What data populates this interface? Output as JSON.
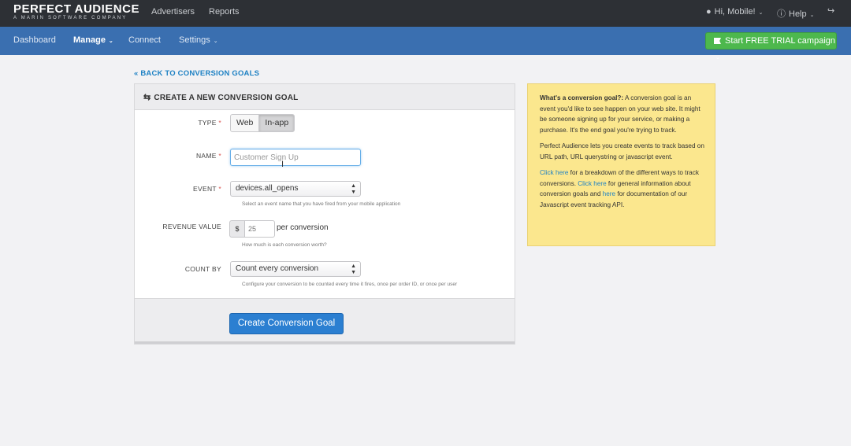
{
  "header": {
    "logo_main": "PERFECT AUDIENCE",
    "logo_sub": "A MARIN SOFTWARE COMPANY",
    "nav": [
      "Advertisers",
      "Reports"
    ],
    "user_label": "Hi, Mobile!",
    "help_label": "Help",
    "user_icon": "user-icon",
    "help_icon": "info-icon",
    "logout_icon": "logout-icon"
  },
  "subnav": {
    "items": [
      {
        "label": "Dashboard",
        "active": false
      },
      {
        "label": "Manage",
        "active": true
      },
      {
        "label": "Connect",
        "active": false
      },
      {
        "label": "Settings",
        "active": false
      }
    ],
    "trial_button": "Start FREE TRIAL campaign"
  },
  "back_link": "« BACK TO CONVERSION GOALS",
  "form": {
    "title": "CREATE A NEW CONVERSION GOAL",
    "type_label": "TYPE",
    "type_options": [
      "Web",
      "In-app"
    ],
    "type_selected": "In-app",
    "name_label": "NAME",
    "name_placeholder": "Customer Sign Up",
    "name_value": "",
    "event_label": "EVENT",
    "event_value": "devices.all_opens",
    "event_help": "Select an event name that you have fired from your mobile application",
    "revenue_label": "REVENUE VALUE",
    "currency_symbol": "$",
    "revenue_value": "25",
    "revenue_suffix": "per conversion",
    "revenue_help": "How much is each conversion worth?",
    "count_label": "COUNT BY",
    "count_value": "Count every conversion",
    "count_help": "Configure your conversion to be counted every time it fires, once per order ID, or once per user",
    "submit_label": "Create Conversion Goal",
    "required_mark": "*"
  },
  "info": {
    "heading": "What's a conversion goal?:",
    "p1_rest": " A conversion goal is an event you'd like to see happen on your web site. It might be someone signing up for your service, or making a purchase. It's the end goal you're trying to track.",
    "p2": "Perfect Audience lets you create events to track based on URL path, URL querystring or javascript event.",
    "p3_link1": "Click here",
    "p3_t1": " for a breakdown of the different ways to track conversions. ",
    "p3_link2": "Click here",
    "p3_t2": " for general information about conversion goals and ",
    "p3_link3": "here",
    "p3_t3": " for documentation of our Javascript event tracking API."
  },
  "colors": {
    "topbar": "#2d3035",
    "subnav": "#3a6fb0",
    "trial_button": "#4db84d",
    "primary_button": "#2b7fd1",
    "info_box": "#fbe78e",
    "link": "#1f82c4"
  }
}
